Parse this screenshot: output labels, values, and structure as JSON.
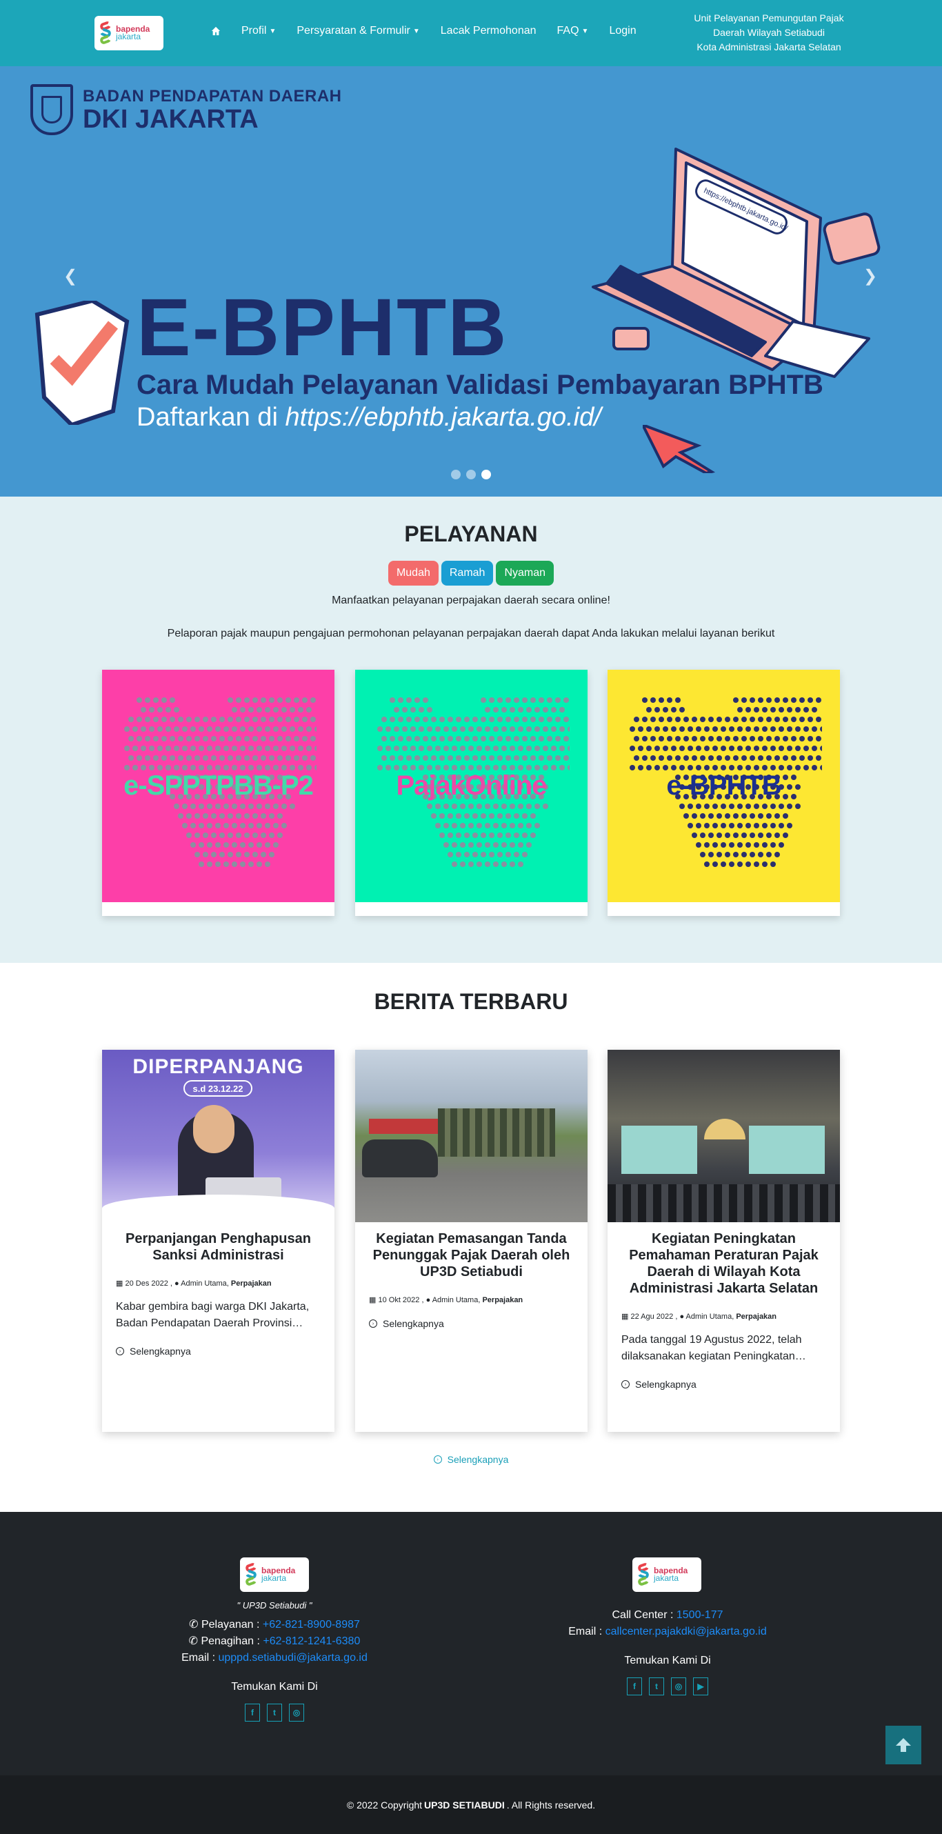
{
  "brand": {
    "logo_line1": "bapenda",
    "logo_line2": "jakarta"
  },
  "nav": {
    "items": [
      {
        "label": "Profil",
        "dropdown": true
      },
      {
        "label": "Persyaratan & Formulir",
        "dropdown": true
      },
      {
        "label": "Lacak Permohonan",
        "dropdown": false
      },
      {
        "label": "FAQ",
        "dropdown": true
      },
      {
        "label": "Login",
        "dropdown": false
      }
    ],
    "unit_lines": [
      "Unit Pelayanan Pemungutan Pajak",
      "Daerah Wilayah Setiabudi",
      "Kota Administrasi Jakarta Selatan"
    ]
  },
  "hero": {
    "org_line1": "BADAN PENDAPATAN DAERAH",
    "org_line2": "DKI JAKARTA",
    "title": "E-BPHTB",
    "subtitle": "Cara Mudah Pelayanan Validasi Pembayaran BPHTB",
    "register_prefix": "Daftarkan di ",
    "register_url": "https://ebphtb.jakarta.go.id/",
    "laptop_url": "https://ebphtb.jakarta.go.id/",
    "active_slide": 3,
    "slide_count": 3
  },
  "pelayanan": {
    "title": "PELAYANAN",
    "badges": [
      "Mudah",
      "Ramah",
      "Nyaman"
    ],
    "text1": "Manfaatkan pelayanan perpajakan daerah secara online!",
    "text2": "Pelaporan pajak maupun pengajuan permohonan pelayanan perpajakan daerah dapat Anda lakukan melalui layanan berikut",
    "services": [
      {
        "label_a": "e-SPPT",
        "label_b": "PBB-P2",
        "bg": "#fd3fa8",
        "dot": "#8a8fa0",
        "label_color": "#44d8a9"
      },
      {
        "label_a": "Pajak",
        "label_b": "Online",
        "bg": "#00f1b2",
        "dot": "#8a8fa0",
        "label_color": "#ea4aa7"
      },
      {
        "label_a": "e-",
        "label_b": "BPHTB",
        "bg": "#fde732",
        "dot": "#2b2f6e",
        "label_color": "#1b2f8f"
      }
    ]
  },
  "berita": {
    "title": "BERITA TERBARU",
    "articles": [
      {
        "img_text": "DIPERPANJANG",
        "img_date": "s.d 23.12.22",
        "title": "Perpanjangan Penghapusan Sanksi Administrasi",
        "date": "20 Des 2022",
        "author": "Admin Utama",
        "category": "Perpajakan",
        "excerpt": "Kabar gembira bagi warga DKI Jakarta, Badan Pendapatan Daerah Provinsi…",
        "more": "Selengkapnya"
      },
      {
        "img_text": "",
        "img_date": "",
        "title": "Kegiatan Pemasangan Tanda Penunggak Pajak Daerah oleh UP3D Setiabudi",
        "date": "10 Okt 2022",
        "author": "Admin Utama",
        "category": "Perpajakan",
        "excerpt": "",
        "more": "Selengkapnya"
      },
      {
        "img_text": "",
        "img_date": "",
        "title": "Kegiatan Peningkatan Pemahaman Peraturan Pajak Daerah di Wilayah Kota Administrasi Jakarta Selatan",
        "date": "22 Agu 2022",
        "author": "Admin Utama",
        "category": "Perpajakan",
        "excerpt": "Pada tanggal 19 Agustus 2022, telah dilaksanakan kegiatan Peningkatan…",
        "more": "Selengkapnya"
      }
    ],
    "all_more": "Selengkapnya"
  },
  "footer": {
    "tagline": "\" UP3D Setiabudi \"",
    "pelayanan_label": "Pelayanan : ",
    "pelayanan_phone": "+62-821-8900-8987",
    "penagihan_label": "Penagihan : ",
    "penagihan_phone": "+62-812-1241-6380",
    "email_label": "Email : ",
    "email": "upppd.setiabudi@jakarta.go.id",
    "find_us": "Temukan Kami Di",
    "callcenter_label": "Call Center : ",
    "callcenter": "1500-177",
    "email2_label": "Email : ",
    "email2": "callcenter.pajakdki@jakarta.go.id",
    "find_us2": "Temukan Kami Di",
    "copyright_prefix": "© 2022 Copyright ",
    "copyright_name": "UP3D SETIABUDI",
    "copyright_suffix": " . All Rights reserved."
  },
  "colors": {
    "nav": "#1ca6b9",
    "hero": "#4497d0",
    "pelayanan_bg": "#e2f0f3",
    "footer": "#212529"
  }
}
